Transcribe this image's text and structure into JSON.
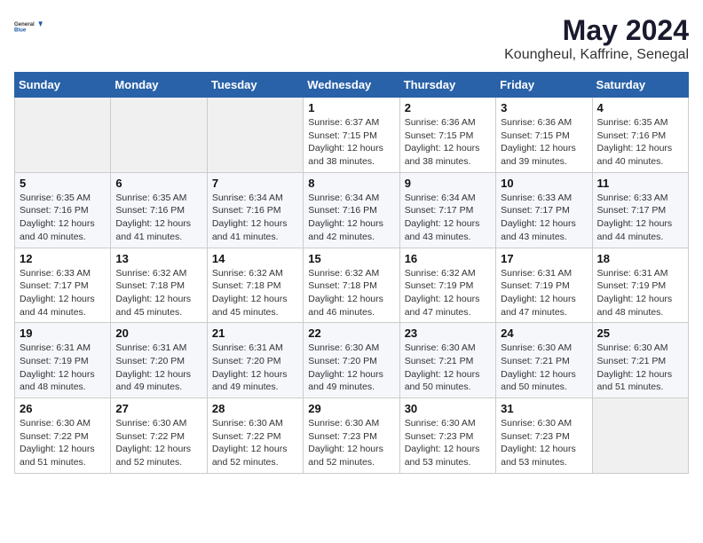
{
  "header": {
    "logo_general": "General",
    "logo_blue": "Blue",
    "title": "May 2024",
    "location": "Koungheul, Kaffrine, Senegal"
  },
  "weekdays": [
    "Sunday",
    "Monday",
    "Tuesday",
    "Wednesday",
    "Thursday",
    "Friday",
    "Saturday"
  ],
  "weeks": [
    [
      {
        "day": "",
        "info": ""
      },
      {
        "day": "",
        "info": ""
      },
      {
        "day": "",
        "info": ""
      },
      {
        "day": "1",
        "info": "Sunrise: 6:37 AM\nSunset: 7:15 PM\nDaylight: 12 hours\nand 38 minutes."
      },
      {
        "day": "2",
        "info": "Sunrise: 6:36 AM\nSunset: 7:15 PM\nDaylight: 12 hours\nand 38 minutes."
      },
      {
        "day": "3",
        "info": "Sunrise: 6:36 AM\nSunset: 7:15 PM\nDaylight: 12 hours\nand 39 minutes."
      },
      {
        "day": "4",
        "info": "Sunrise: 6:35 AM\nSunset: 7:16 PM\nDaylight: 12 hours\nand 40 minutes."
      }
    ],
    [
      {
        "day": "5",
        "info": "Sunrise: 6:35 AM\nSunset: 7:16 PM\nDaylight: 12 hours\nand 40 minutes."
      },
      {
        "day": "6",
        "info": "Sunrise: 6:35 AM\nSunset: 7:16 PM\nDaylight: 12 hours\nand 41 minutes."
      },
      {
        "day": "7",
        "info": "Sunrise: 6:34 AM\nSunset: 7:16 PM\nDaylight: 12 hours\nand 41 minutes."
      },
      {
        "day": "8",
        "info": "Sunrise: 6:34 AM\nSunset: 7:16 PM\nDaylight: 12 hours\nand 42 minutes."
      },
      {
        "day": "9",
        "info": "Sunrise: 6:34 AM\nSunset: 7:17 PM\nDaylight: 12 hours\nand 43 minutes."
      },
      {
        "day": "10",
        "info": "Sunrise: 6:33 AM\nSunset: 7:17 PM\nDaylight: 12 hours\nand 43 minutes."
      },
      {
        "day": "11",
        "info": "Sunrise: 6:33 AM\nSunset: 7:17 PM\nDaylight: 12 hours\nand 44 minutes."
      }
    ],
    [
      {
        "day": "12",
        "info": "Sunrise: 6:33 AM\nSunset: 7:17 PM\nDaylight: 12 hours\nand 44 minutes."
      },
      {
        "day": "13",
        "info": "Sunrise: 6:32 AM\nSunset: 7:18 PM\nDaylight: 12 hours\nand 45 minutes."
      },
      {
        "day": "14",
        "info": "Sunrise: 6:32 AM\nSunset: 7:18 PM\nDaylight: 12 hours\nand 45 minutes."
      },
      {
        "day": "15",
        "info": "Sunrise: 6:32 AM\nSunset: 7:18 PM\nDaylight: 12 hours\nand 46 minutes."
      },
      {
        "day": "16",
        "info": "Sunrise: 6:32 AM\nSunset: 7:19 PM\nDaylight: 12 hours\nand 47 minutes."
      },
      {
        "day": "17",
        "info": "Sunrise: 6:31 AM\nSunset: 7:19 PM\nDaylight: 12 hours\nand 47 minutes."
      },
      {
        "day": "18",
        "info": "Sunrise: 6:31 AM\nSunset: 7:19 PM\nDaylight: 12 hours\nand 48 minutes."
      }
    ],
    [
      {
        "day": "19",
        "info": "Sunrise: 6:31 AM\nSunset: 7:19 PM\nDaylight: 12 hours\nand 48 minutes."
      },
      {
        "day": "20",
        "info": "Sunrise: 6:31 AM\nSunset: 7:20 PM\nDaylight: 12 hours\nand 49 minutes."
      },
      {
        "day": "21",
        "info": "Sunrise: 6:31 AM\nSunset: 7:20 PM\nDaylight: 12 hours\nand 49 minutes."
      },
      {
        "day": "22",
        "info": "Sunrise: 6:30 AM\nSunset: 7:20 PM\nDaylight: 12 hours\nand 49 minutes."
      },
      {
        "day": "23",
        "info": "Sunrise: 6:30 AM\nSunset: 7:21 PM\nDaylight: 12 hours\nand 50 minutes."
      },
      {
        "day": "24",
        "info": "Sunrise: 6:30 AM\nSunset: 7:21 PM\nDaylight: 12 hours\nand 50 minutes."
      },
      {
        "day": "25",
        "info": "Sunrise: 6:30 AM\nSunset: 7:21 PM\nDaylight: 12 hours\nand 51 minutes."
      }
    ],
    [
      {
        "day": "26",
        "info": "Sunrise: 6:30 AM\nSunset: 7:22 PM\nDaylight: 12 hours\nand 51 minutes."
      },
      {
        "day": "27",
        "info": "Sunrise: 6:30 AM\nSunset: 7:22 PM\nDaylight: 12 hours\nand 52 minutes."
      },
      {
        "day": "28",
        "info": "Sunrise: 6:30 AM\nSunset: 7:22 PM\nDaylight: 12 hours\nand 52 minutes."
      },
      {
        "day": "29",
        "info": "Sunrise: 6:30 AM\nSunset: 7:23 PM\nDaylight: 12 hours\nand 52 minutes."
      },
      {
        "day": "30",
        "info": "Sunrise: 6:30 AM\nSunset: 7:23 PM\nDaylight: 12 hours\nand 53 minutes."
      },
      {
        "day": "31",
        "info": "Sunrise: 6:30 AM\nSunset: 7:23 PM\nDaylight: 12 hours\nand 53 minutes."
      },
      {
        "day": "",
        "info": ""
      }
    ]
  ]
}
